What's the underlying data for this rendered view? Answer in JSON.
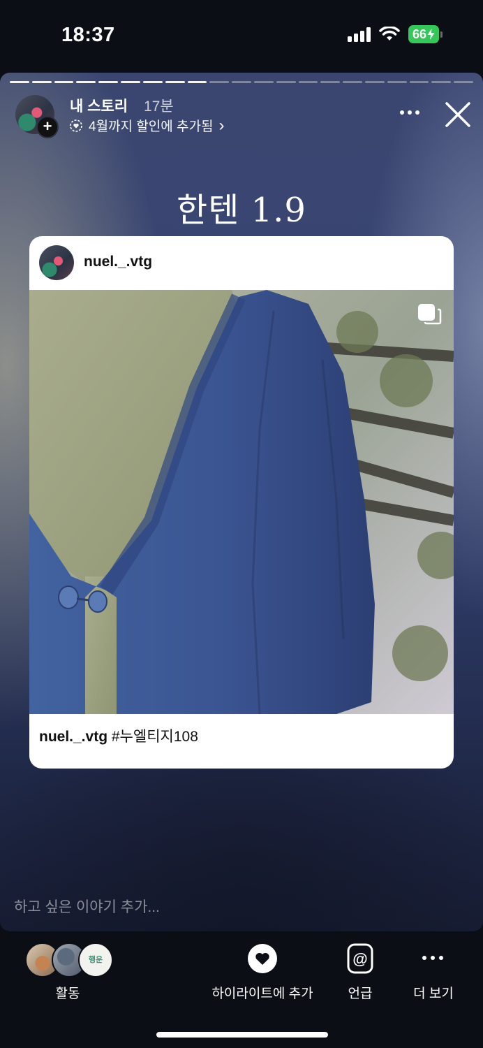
{
  "status_bar": {
    "time": "18:37",
    "battery": "66",
    "charging": true
  },
  "story": {
    "progress_segments": 21,
    "progress_done": 9,
    "user_label": "내 스토리",
    "time_ago": "17분",
    "added_to_label": "4월까지 할인에 추가됨",
    "chevron": "›",
    "sticker_title": "한텐 1.9",
    "reply_placeholder": "하고 싶은 이야기 추가..."
  },
  "shared_post": {
    "username": "nuel._.vtg",
    "caption_user": "nuel._.vtg",
    "caption_text": "#누엘티지108"
  },
  "bottom_bar": {
    "activity_label": "활동",
    "activity_third_avatar_text": "행운",
    "highlight_label": "하이라이트에 추가",
    "mention_label": "언급",
    "more_label": "더 보기"
  },
  "colors": {
    "background": "#0b0e14",
    "battery_green": "#35c759",
    "story_blue": "#394572",
    "cardigan_blue": "#3f5f9f"
  },
  "icons": {
    "more": "more-horizontal-icon",
    "close": "close-icon",
    "highlight": "heart-circle-icon",
    "mention": "at-sign-icon",
    "sub": "collection-icon",
    "multi_photo": "carousel-icon"
  }
}
